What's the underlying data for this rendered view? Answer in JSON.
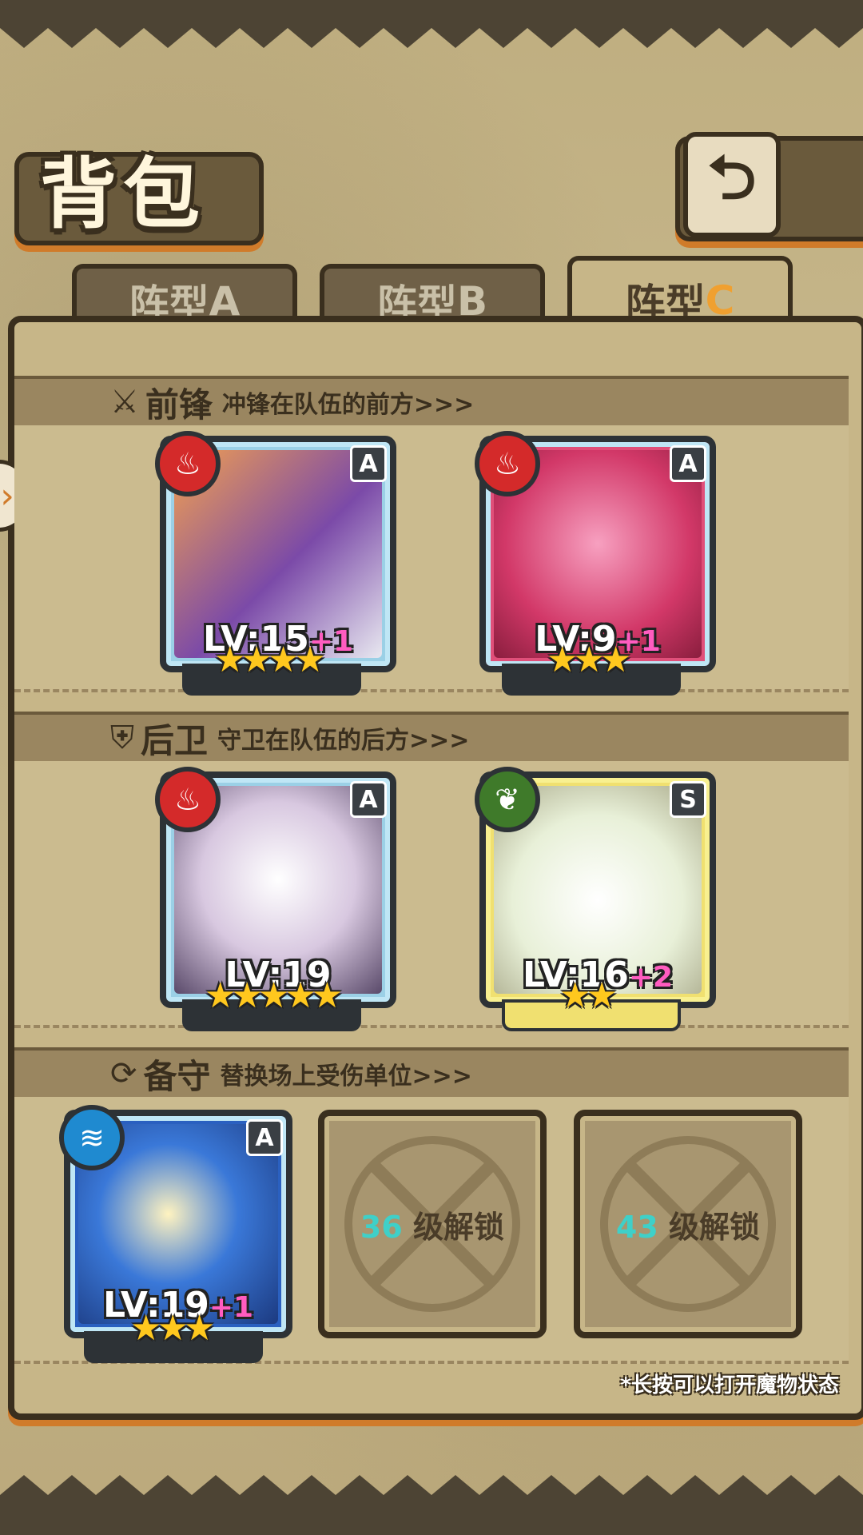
{
  "header": {
    "title": "背包",
    "back_icon": "back-arrow-icon"
  },
  "tabs": [
    {
      "label": "阵型",
      "letter": "A",
      "active": false
    },
    {
      "label": "阵型",
      "letter": "B",
      "active": false
    },
    {
      "label": "阵型",
      "letter": "C",
      "active": true
    }
  ],
  "sections": {
    "front": {
      "name": "前锋",
      "desc": "冲锋在队伍的前方>>>",
      "icon": "sword-icon"
    },
    "back": {
      "name": "后卫",
      "desc": "守卫在队伍的后方>>>",
      "icon": "shield-icon"
    },
    "reserve": {
      "name": "备守",
      "desc": "替换场上受伤单位>>>",
      "icon": "swap-icon"
    }
  },
  "units": [
    {
      "rank": "A",
      "element": "fire",
      "lv_label": "LV:",
      "level": "15",
      "bonus": "+1",
      "stars": 4,
      "stars_text": "★★★★"
    },
    {
      "rank": "A",
      "element": "fire",
      "lv_label": "LV:",
      "level": "9",
      "bonus": "+1",
      "stars": 3,
      "stars_text": "★★★"
    },
    {
      "rank": "A",
      "element": "fire",
      "lv_label": "LV:",
      "level": "19",
      "bonus": "",
      "stars": 5,
      "stars_text": "★★★★★"
    },
    {
      "rank": "S",
      "element": "leaf",
      "lv_label": "LV:",
      "level": "16",
      "bonus": "+2",
      "stars": 2,
      "stars_text": "★★"
    },
    {
      "rank": "A",
      "element": "water",
      "lv_label": "LV:",
      "level": "19",
      "bonus": "+1",
      "stars": 3,
      "stars_text": "★★★"
    }
  ],
  "locked_slots": [
    {
      "level": "36",
      "label": "级解锁"
    },
    {
      "level": "43",
      "label": "级解锁"
    }
  ],
  "hint": "*长按可以打开魔物状态",
  "colors": {
    "fire": "#d42a2a",
    "leaf": "#3f7a2a",
    "water": "#1f8ad0",
    "accent": "#d07b2a"
  }
}
